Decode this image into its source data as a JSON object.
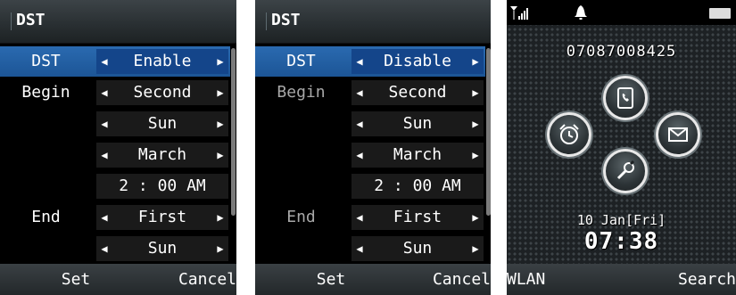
{
  "screen1": {
    "title": "DST",
    "rows": [
      {
        "label": "DST",
        "value": "Enable"
      },
      {
        "label": "Begin",
        "value": "Second"
      },
      {
        "label": "",
        "value": "Sun"
      },
      {
        "label": "",
        "value": "March"
      },
      {
        "label": "",
        "value": "2 : 00 AM"
      },
      {
        "label": "End",
        "value": "First"
      },
      {
        "label": "",
        "value": "Sun"
      }
    ],
    "softkeys": {
      "left": "",
      "center": "Set",
      "right": "Cancel"
    }
  },
  "screen2": {
    "title": "DST",
    "rows": [
      {
        "label": "DST",
        "value": "Disable"
      },
      {
        "label": "Begin",
        "value": "Second"
      },
      {
        "label": "",
        "value": "Sun"
      },
      {
        "label": "",
        "value": "March"
      },
      {
        "label": "",
        "value": "2 : 00 AM"
      },
      {
        "label": "End",
        "value": "First"
      },
      {
        "label": "",
        "value": "Sun"
      }
    ],
    "softkeys": {
      "left": "",
      "center": "Set",
      "right": "Cancel"
    }
  },
  "screen3": {
    "status_icons": [
      "signal-icon",
      "bell-icon",
      "battery-icon"
    ],
    "phone_number": "07087008425",
    "shortcuts": [
      "phonebook-icon",
      "alarm-icon",
      "message-icon",
      "settings-icon"
    ],
    "date": "10 Jan[Fri]",
    "time": "07:38",
    "softkeys": {
      "left": "WLAN",
      "right": "Search"
    }
  },
  "colors": {
    "highlight": "#2a6ab0",
    "background": "#000000",
    "value_box": "#1a1a1a"
  }
}
